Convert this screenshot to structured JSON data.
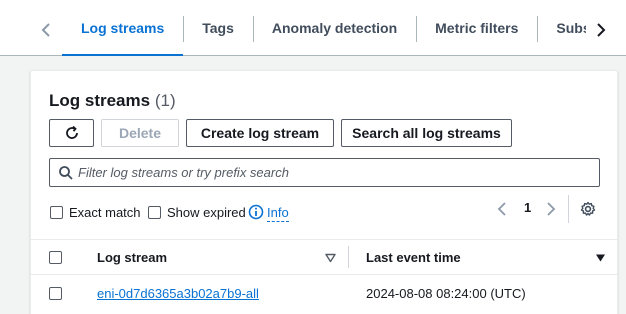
{
  "tabs": [
    {
      "label": "Log streams",
      "active": true
    },
    {
      "label": "Tags",
      "active": false
    },
    {
      "label": "Anomaly detection",
      "active": false
    },
    {
      "label": "Metric filters",
      "active": false
    },
    {
      "label": "Subscription filters",
      "active": false
    }
  ],
  "panel": {
    "title": "Log streams",
    "count": "(1)",
    "buttons": {
      "refresh": "refresh-icon",
      "delete": "Delete",
      "create": "Create log stream",
      "search_all": "Search all log streams"
    },
    "search": {
      "placeholder": "Filter log streams or try prefix search",
      "value": ""
    },
    "filters": {
      "exact_match": "Exact match",
      "show_expired": "Show expired",
      "info": "Info"
    },
    "pagination": {
      "current_page": "1"
    },
    "table": {
      "columns": [
        "Log stream",
        "Last event time"
      ],
      "rows": [
        {
          "log_stream": "eni-0d7d6365a3b02a7b9-all",
          "last_event_time": "2024-08-08 08:24:00 (UTC)"
        }
      ]
    }
  },
  "colors": {
    "accent": "#0972d3",
    "border": "#545b64",
    "background": "#f2f3f3"
  }
}
